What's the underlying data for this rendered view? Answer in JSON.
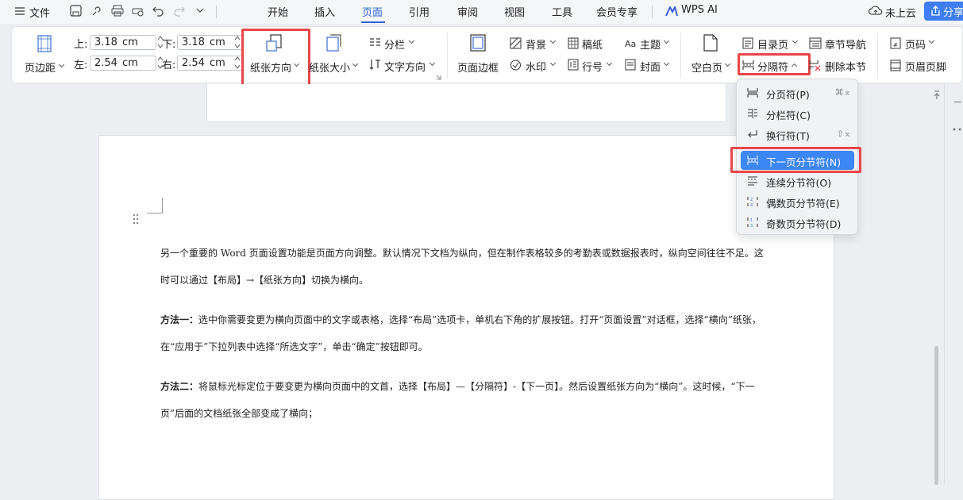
{
  "topbar": {
    "file_label": "文件",
    "tabs": [
      "开始",
      "插入",
      "页面",
      "引用",
      "审阅",
      "视图",
      "工具",
      "会员专享"
    ],
    "active_tab": "页面",
    "wps_ai_label": "WPS AI",
    "cloud_label": "未上云",
    "share_label": "分享"
  },
  "ribbon": {
    "margin_label": "页边距",
    "top_label": "上:",
    "top_value": "3.18",
    "bottom_label": "下:",
    "bottom_value": "3.18",
    "left_label": "左:",
    "left_value": "2.54",
    "right_label": "右:",
    "right_value": "2.54",
    "unit": "cm",
    "orientation_label": "纸张方向",
    "size_label": "纸张大小",
    "columns_label": "分栏",
    "text_dir_label": "文字方向",
    "page_border_label": "页面边框",
    "background_label": "背景",
    "watermark_label": "水印",
    "manuscript_label": "稿纸",
    "line_num_label": "行号",
    "theme_label": "主题",
    "cover_label": "封面",
    "blank_page_label": "空白页",
    "toc_page_label": "目录页",
    "section_break_label": "分隔符",
    "chapter_nav_label": "章节导航",
    "delete_section_label": "删除本节",
    "page_num_label": "页码",
    "header_footer_label": "页眉页脚"
  },
  "menu": {
    "items": [
      {
        "label": "分页符(P)",
        "shortcut": "⌘⌅"
      },
      {
        "label": "分栏符(C)",
        "shortcut": ""
      },
      {
        "label": "换行符(T)",
        "shortcut": "⇧⌅"
      },
      {
        "label": "下一页分节符(N)",
        "shortcut": ""
      },
      {
        "label": "连续分节符(O)",
        "shortcut": ""
      },
      {
        "label": "偶数页分节符(E)",
        "shortcut": ""
      },
      {
        "label": "奇数页分节符(D)",
        "shortcut": ""
      }
    ],
    "selected": "下一页分节符(N)"
  },
  "document": {
    "p1": "另一个重要的 Word 页面设置功能是页面方向调整。默认情况下文档为纵向，但在制作表格较多的考勤表或数据报表时，纵向空间往往不足。这时可以通过【布局】→【纸张方向】切换为横向。",
    "p2_head": "方法一：",
    "p2_body": "选中你需要变更为横向页面中的文字或表格，选择“布局”选项卡，单机右下角的扩展按钮。打开“页面设置”对话框，选择“横向”纸张，在“应用于”下拉列表中选择“所选文字”，单击“确定”按钮即可。",
    "p3_head": "方法二：",
    "p3_body": "将鼠标光标定位于要变更为横向页面中的文首，选择【布局】—【分隔符】-【下一页】。然后设置纸张方向为“横向”。这时候，“下一页”后面的文档纸张全部变成了横向；"
  },
  "colors": {
    "accent": "#2a63d9",
    "highlight": "#e8474b",
    "menu_selected": "#3d86f5"
  }
}
